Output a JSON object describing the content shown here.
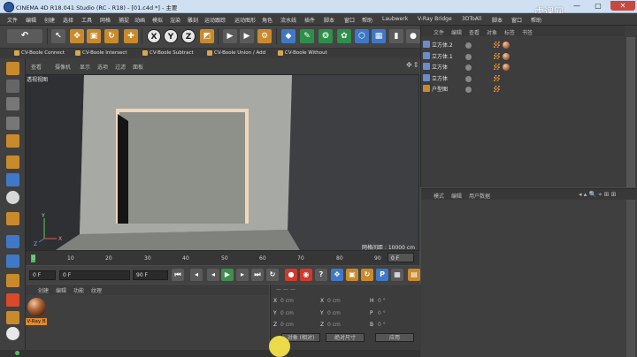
{
  "window": {
    "title": "CINEMA 4D R18.041 Studio (RC - R18) - [01.c4d *] - 主要",
    "watermark": "虎课网",
    "min": "—",
    "max": "▢",
    "close": "✕"
  },
  "menu": [
    "文件",
    "编辑",
    "创建",
    "选择",
    "工具",
    "网格",
    "捕捉",
    "动画",
    "模拟",
    "渲染",
    "雕刻",
    "运动跟踪",
    "运动图形",
    "角色",
    "流水线",
    "插件",
    "脚本",
    "窗口",
    "帮助",
    "Laubwerk",
    "V-Ray Bridge",
    "3DToAll",
    "脚本",
    "窗口",
    "帮助"
  ],
  "toolbar": {
    "x": "X",
    "y": "Y",
    "z": "Z"
  },
  "boole": [
    "CV-Boole Connect",
    "CV-Boole Intersect",
    "CV-Boole Subtract",
    "CV-Boole Union / Add",
    "CV-Boole Without"
  ],
  "viewport": {
    "menus": [
      "查看",
      "摄像机",
      "显示",
      "选项",
      "过滤",
      "面板"
    ],
    "label": "透视视图",
    "grid_readout": "网格间距 : 10000 cm",
    "axis_y": "Y",
    "axis_x": "X",
    "axis_z": "Z"
  },
  "timeline": {
    "ticks": [
      "0",
      "10",
      "20",
      "30",
      "40",
      "50",
      "60",
      "70",
      "80",
      "90"
    ],
    "frame": "0 F"
  },
  "transport": {
    "start": "0 F",
    "current": "0 F",
    "end": "90 F",
    "end2": "90 F"
  },
  "material": {
    "menus": [
      "创建",
      "编辑",
      "功能",
      "纹理"
    ],
    "name": "V-Ray B"
  },
  "coord": {
    "header": "— — —",
    "rows": [
      {
        "a": "X",
        "av": "0 cm",
        "b": "X",
        "bv": "0 cm",
        "c": "H",
        "cv": "0 °"
      },
      {
        "a": "Y",
        "av": "0 cm",
        "b": "Y",
        "bv": "0 cm",
        "c": "P",
        "cv": "0 °"
      },
      {
        "a": "Z",
        "av": "0 cm",
        "b": "Z",
        "bv": "0 cm",
        "c": "B",
        "cv": "0 °"
      }
    ],
    "mode": "对象 (相对)",
    "size": "绝对尺寸",
    "apply": "应用"
  },
  "object_manager": {
    "menus": [
      "文件",
      "编辑",
      "查看",
      "对象",
      "标签",
      "书签"
    ],
    "items": [
      "立方体.2",
      "立方体.1",
      "立方体",
      "立方体",
      "户型图"
    ]
  },
  "attributes": {
    "menus": [
      "模式",
      "编辑",
      "用户数据"
    ]
  }
}
